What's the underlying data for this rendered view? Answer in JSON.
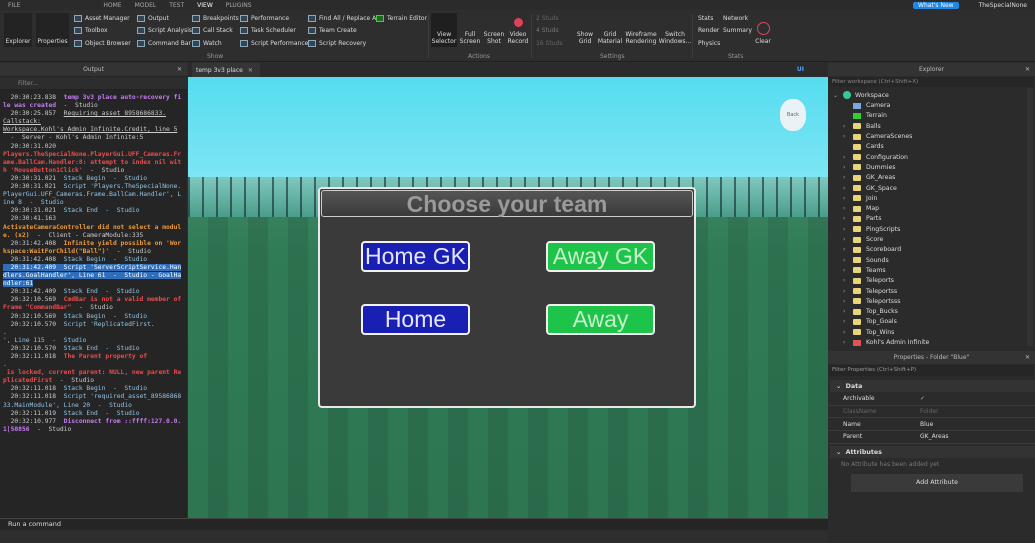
{
  "menubar": {
    "file": "FILE",
    "tabs": [
      "HOME",
      "MODEL",
      "TEST",
      "VIEW",
      "PLUGINS"
    ],
    "active": "VIEW",
    "whats_new": "What's New",
    "user": "TheSpecialNone"
  },
  "ribbon": {
    "explorer": "Explorer",
    "properties": "Properties",
    "show_items": [
      "Asset Manager",
      "Toolbox",
      "Object Browser",
      "Output",
      "Script Analysis",
      "Command Bar",
      "Breakpoints",
      "Call Stack",
      "Watch",
      "Performance",
      "Task Scheduler",
      "Script Performance",
      "Find All / Replace All",
      "Team Create",
      "Script Recovery",
      "Terrain Editor"
    ],
    "show_label": "Show",
    "actions": [
      "View Selector",
      "Full Screen",
      "Screen Shot",
      "Video Record"
    ],
    "actions_label": "Actions",
    "studs": [
      "2 Studs",
      "4 Studs",
      "16 Studs"
    ],
    "settings": [
      "Show Grid",
      "Grid Material",
      "Wireframe Rendering",
      "Switch Windows..."
    ],
    "settings_label": "Settings",
    "stats": [
      "Stats",
      "Network",
      "Render",
      "Summary",
      "Physics"
    ],
    "clear": "Clear",
    "stats_label": "Stats"
  },
  "output": {
    "title": "Output",
    "filter_placeholder": "Filter...",
    "lines": [
      {
        "t": "  20:30:23.838  ",
        "c": "w"
      },
      {
        "t": "temp 3v3 place auto-recovery file was created",
        "c": "p"
      },
      {
        "t": "  -  Studio\n",
        "c": "w"
      },
      {
        "t": "  20:30:25.857  ",
        "c": "w"
      },
      {
        "t": "Requiring asset 8958686833.\nCallstack:\nWorkspace.Kohl's Admin Infinite.Credit, line 5",
        "c": "w",
        "u": true
      },
      {
        "t": "\n  -  Server - Kohl's Admin Infinite:5\n  20:30:31.020\n",
        "c": "w"
      },
      {
        "t": "Players.TheSpecialNone.PlayerGui.UFF_Cameras.Frame.BallCam.Handler:8: attempt to index nil with 'MouseButton1Click'",
        "c": "r"
      },
      {
        "t": "  -  Studio\n",
        "c": "w"
      },
      {
        "t": "  20:30:31.021  ",
        "c": "w"
      },
      {
        "t": "Stack Begin  -  Studio\n",
        "c": "b"
      },
      {
        "t": "  20:30:31.021  ",
        "c": "w"
      },
      {
        "t": "Script 'Players.TheSpecialNone.PlayerGui.UFF_Cameras.Frame.BallCam.Handler', Line 8  -  Studio\n",
        "c": "b"
      },
      {
        "t": "  20:30:31.021  ",
        "c": "w"
      },
      {
        "t": "Stack End  -  Studio\n",
        "c": "b"
      },
      {
        "t": "  20:30:41.163  \n",
        "c": "w"
      },
      {
        "t": "ActivateCameraController did not select a module. (x2)",
        "c": "o"
      },
      {
        "t": "  -  Client - CameraModule:335\n",
        "c": "w"
      },
      {
        "t": "  20:31:42.408  ",
        "c": "w"
      },
      {
        "t": "Infinite yield possible on 'Workspace:WaitForChild(\"Ball\")'",
        "c": "o"
      },
      {
        "t": "  -  Studio\n",
        "c": "w"
      },
      {
        "t": "  20:31:42.408  ",
        "c": "w"
      },
      {
        "t": "Stack Begin  -  Studio\n",
        "c": "b"
      },
      {
        "t": "  20:31:42.409  Script 'ServerScriptService.Handlers.GoalHandler', Line 61  -  Studio - GoalHandler:61",
        "c": "b",
        "h": true
      },
      {
        "t": "\n",
        "c": "w"
      },
      {
        "t": "  20:31:42.409  ",
        "c": "w"
      },
      {
        "t": "Stack End  -  Studio\n",
        "c": "b"
      },
      {
        "t": "  20:32:10.569  ",
        "c": "w"
      },
      {
        "t": "CmdBar is not a valid member of Frame \"CommandBar\"",
        "c": "r"
      },
      {
        "t": "  -  Studio\n",
        "c": "w"
      },
      {
        "t": "  20:32:10.569  ",
        "c": "w"
      },
      {
        "t": "Stack Begin  -  Studio\n",
        "c": "b"
      },
      {
        "t": "  20:32:10.570  ",
        "c": "w"
      },
      {
        "t": "Script 'ReplicatedFirst.\n.\n', Line 115  -  Studio\n",
        "c": "b"
      },
      {
        "t": "  20:32:10.570  ",
        "c": "w"
      },
      {
        "t": "Stack End  -  Studio\n",
        "c": "b"
      },
      {
        "t": "  20:32:11.018  ",
        "c": "w"
      },
      {
        "t": "The Parent property of\n.\n is locked, current parent: NULL, new parent ReplicatedFirst",
        "c": "r"
      },
      {
        "t": "  -  Studio\n",
        "c": "w"
      },
      {
        "t": "  20:32:11.018  ",
        "c": "w"
      },
      {
        "t": "Stack Begin  -  Studio\n",
        "c": "b"
      },
      {
        "t": "  20:32:11.018  ",
        "c": "w"
      },
      {
        "t": "Script 'required_asset_8958686833.MainModule', Line 20  -  Studio\n",
        "c": "b"
      },
      {
        "t": "  20:32:11.019  ",
        "c": "w"
      },
      {
        "t": "Stack End  -  Studio\n",
        "c": "b"
      },
      {
        "t": "  20:32:10.977  ",
        "c": "w"
      },
      {
        "t": "Disconnect from ::ffff:127.0.0.1|50856",
        "c": "p"
      },
      {
        "t": "  -  Studio",
        "c": "w"
      }
    ]
  },
  "command_bar": {
    "placeholder": "Run a command"
  },
  "viewport": {
    "tab": "temp 3v3 place",
    "ui_toggle": "UI",
    "back": "Back",
    "dialog_title": "Choose your team",
    "buttons": [
      "Home GK",
      "Away GK",
      "Home",
      "Away"
    ]
  },
  "explorer": {
    "title": "Explorer",
    "filter_placeholder": "Filter workspace (Ctrl+Shift+X)",
    "root": "Workspace",
    "items": [
      {
        "n": "Camera",
        "i": "camera"
      },
      {
        "n": "Terrain",
        "i": "terrain"
      },
      {
        "n": "Balls",
        "i": "folder",
        "e": true
      },
      {
        "n": "CameraScenes",
        "i": "folder",
        "e": true
      },
      {
        "n": "Cards",
        "i": "folder"
      },
      {
        "n": "Configuration",
        "i": "folder",
        "e": true
      },
      {
        "n": "Dummies",
        "i": "folder",
        "e": true
      },
      {
        "n": "GK_Areas",
        "i": "folder",
        "e": true
      },
      {
        "n": "GK_Space",
        "i": "folder",
        "e": true
      },
      {
        "n": "Join",
        "i": "folder",
        "e": true
      },
      {
        "n": "Map",
        "i": "folder",
        "e": true
      },
      {
        "n": "Parts",
        "i": "folder",
        "e": true
      },
      {
        "n": "PingScripts",
        "i": "folder",
        "e": true
      },
      {
        "n": "Score",
        "i": "folder",
        "e": true
      },
      {
        "n": "Scoreboard",
        "i": "folder",
        "e": true
      },
      {
        "n": "Sounds",
        "i": "folder",
        "e": true
      },
      {
        "n": "Teams",
        "i": "folder",
        "e": true
      },
      {
        "n": "Teleports",
        "i": "folder",
        "e": true
      },
      {
        "n": "Teleportss",
        "i": "folder",
        "e": true
      },
      {
        "n": "Teleportsss",
        "i": "folder",
        "e": true
      },
      {
        "n": "Top_Bucks",
        "i": "folder",
        "e": true
      },
      {
        "n": "Top_Goals",
        "i": "folder",
        "e": true
      },
      {
        "n": "Top_Wins",
        "i": "folder",
        "e": true
      },
      {
        "n": "Kohl's Admin Infinite",
        "i": "model",
        "e": true
      }
    ]
  },
  "properties": {
    "title": "Properties - Folder \"Blue\"",
    "filter_placeholder": "Filter Properties (Ctrl+Shift+P)",
    "data_section": "Data",
    "rows": [
      {
        "k": "Archivable",
        "v": "✓"
      },
      {
        "k": "ClassName",
        "v": "Folder",
        "dim": true
      },
      {
        "k": "Name",
        "v": "Blue"
      },
      {
        "k": "Parent",
        "v": "GK_Areas"
      }
    ],
    "attributes_section": "Attributes",
    "no_attributes": "No Attribute has been added yet",
    "add_attribute": "Add Attribute"
  }
}
